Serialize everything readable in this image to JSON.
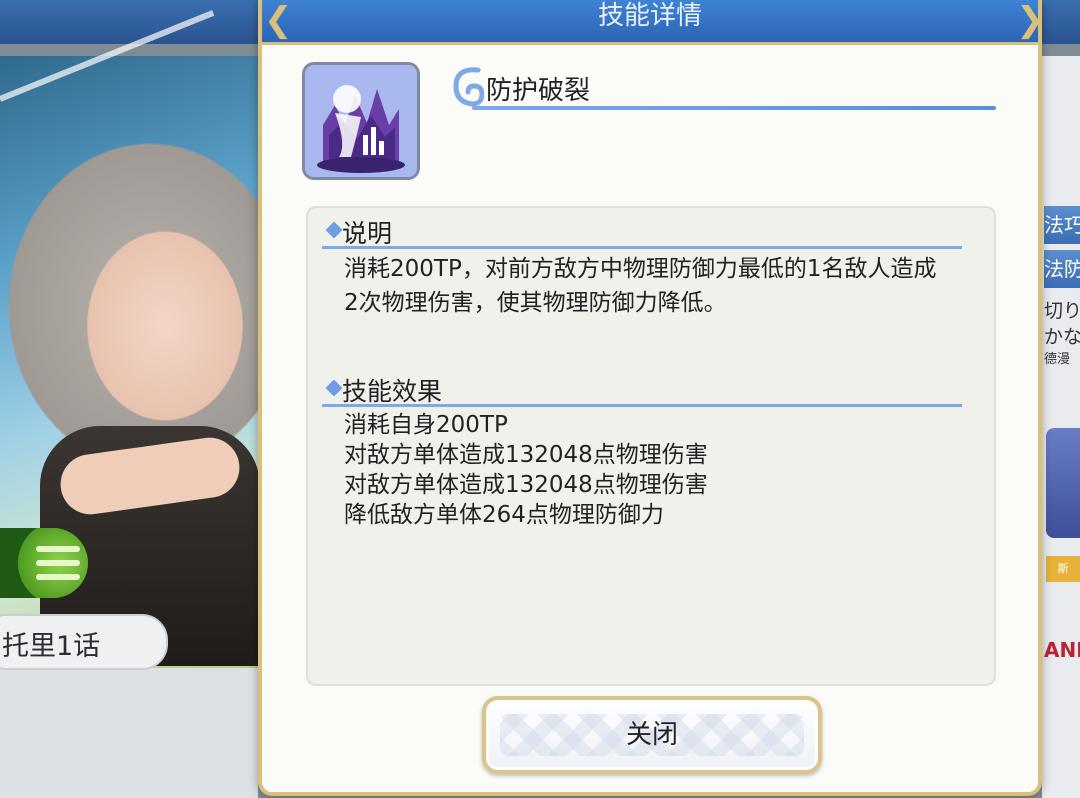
{
  "background": {
    "story_button_label": "托里1话",
    "right_panel": {
      "tab1": "法巧",
      "tab2": "法防",
      "text1": "切り",
      "text2": "かな",
      "text3": "德漫",
      "badge": "斯",
      "rank": "ANK"
    }
  },
  "dialog": {
    "title": "技能详情",
    "skill_name": "防护破裂",
    "skill_icon": "broken-shield-icon",
    "description_header": "说明",
    "description": "消耗200TP，对前方敌方中物理防御力最低的1名敌人造成2次物理伤害，使其物理防御力降低。",
    "effects_header": "技能效果",
    "effects": [
      "消耗自身200TP",
      "对敌方单体造成132048点物理伤害",
      "对敌方单体造成132048点物理伤害",
      "降低敌方单体264点物理防御力"
    ],
    "close_label": "关闭"
  },
  "colors": {
    "header_blue": "#3f83d4",
    "gold_border": "#d8c07a",
    "accent_line": "#7ea8e6"
  }
}
